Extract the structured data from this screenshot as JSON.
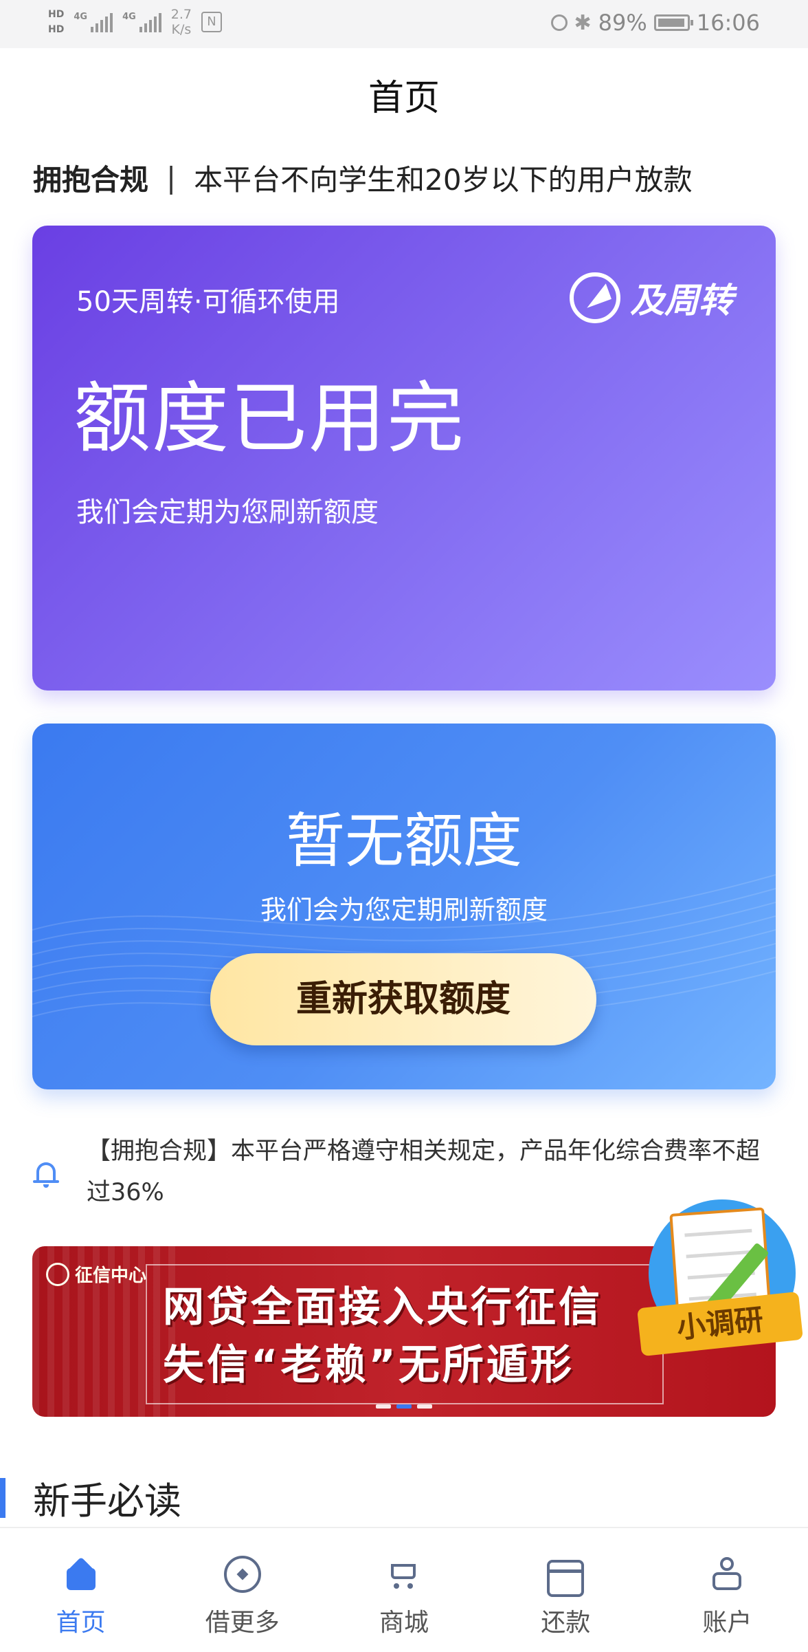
{
  "statusbar": {
    "hd1": "HD",
    "hd2": "HD",
    "net1": "4G",
    "net2": "4G",
    "speed_value": "2.7",
    "speed_unit": "K/s",
    "nfc": "N",
    "battery": "89%",
    "time": "16:06"
  },
  "page_title": "首页",
  "notice_top": {
    "strong": "拥抱合规",
    "separator": "|",
    "text": "本平台不向学生和20岁以下的用户放款"
  },
  "card_quota": {
    "subtitle": "50天周转·可循环使用",
    "brand": "及周转",
    "status": "额度已用完",
    "desc": "我们会定期为您刷新额度"
  },
  "card_none": {
    "status": "暂无额度",
    "desc": "我们会为您定期刷新额度",
    "button": "重新获取额度"
  },
  "notice_compliance": "【拥抱合规】本平台严格遵守相关规定，产品年化综合费率不超过36%",
  "banner": {
    "logo": "征信中心",
    "line1": "网贷全面接入央行征信",
    "line2": "失信“老赖”无所遁形",
    "slides": 3,
    "active_slide": 1
  },
  "survey_badge": "小调研",
  "section_title": "新手必读",
  "tabs": [
    {
      "label": "首页",
      "icon": "home-icon",
      "active": true
    },
    {
      "label": "借更多",
      "icon": "borrow-icon",
      "active": false
    },
    {
      "label": "商城",
      "icon": "cart-icon",
      "active": false
    },
    {
      "label": "还款",
      "icon": "card-icon",
      "active": false
    },
    {
      "label": "账户",
      "icon": "account-icon",
      "active": false
    }
  ],
  "colors": {
    "accent": "#3b7af0",
    "card_purple": "#7b5cf0",
    "card_blue": "#4f8ef5",
    "button_gold": "#ffe6a3",
    "banner_red": "#c0222a"
  }
}
